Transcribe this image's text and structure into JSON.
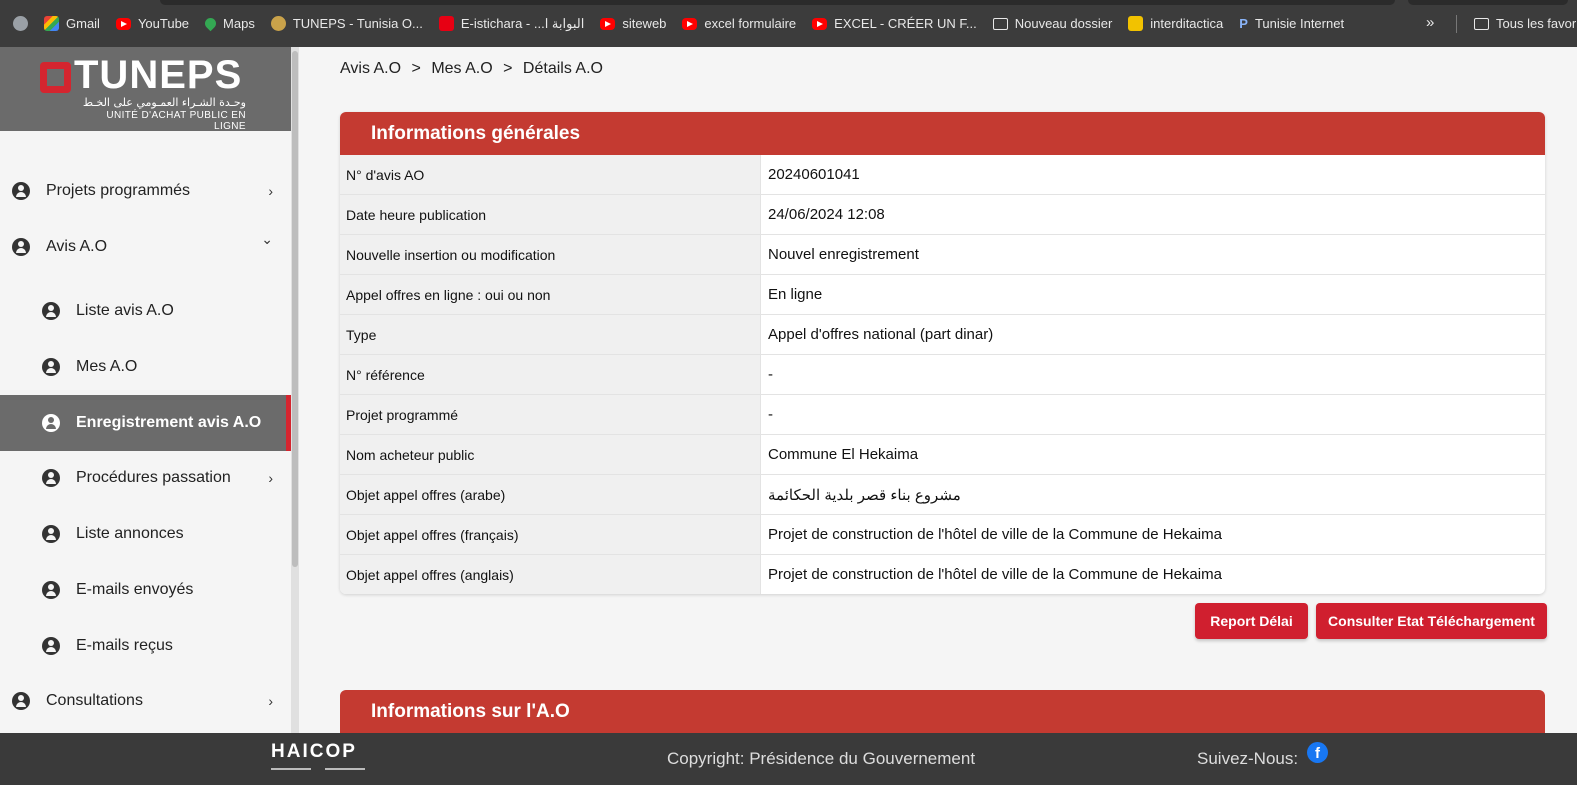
{
  "bookmarks": {
    "items": [
      {
        "label": "Gmail",
        "icon": "gmail-icon"
      },
      {
        "label": "YouTube",
        "icon": "youtube-icon"
      },
      {
        "label": "Maps",
        "icon": "maps-icon"
      },
      {
        "label": "TUNEPS - Tunisia O...",
        "icon": "tuneps-icon"
      },
      {
        "label": "E-istichara - ...البوابة ا",
        "icon": "tunisia-flag-icon"
      },
      {
        "label": "siteweb",
        "icon": "youtube-icon"
      },
      {
        "label": "excel formulaire",
        "icon": "youtube-icon"
      },
      {
        "label": "EXCEL - CRÉER UN F...",
        "icon": "youtube-icon"
      },
      {
        "label": "Nouveau dossier",
        "icon": "folder-icon"
      },
      {
        "label": "interditactica",
        "icon": "interditactica-icon"
      },
      {
        "label": "Tunisie Internet",
        "icon": "p-icon"
      }
    ],
    "more": "»",
    "all_bookmarks": "Tous les favoris"
  },
  "logo": {
    "name": "TUNEPS",
    "arabic": "وحـدة الشـراء العمـومي على الخـط",
    "subtitle": "UNITÉ D'ACHAT PUBLIC EN LIGNE"
  },
  "sidebar": {
    "items": [
      {
        "label": "Projets programmés",
        "chevron": "›"
      },
      {
        "label": "Avis A.O",
        "chevron": "⌄"
      },
      {
        "label": "Liste avis A.O"
      },
      {
        "label": "Mes A.O"
      },
      {
        "label": "Enregistrement avis A.O"
      },
      {
        "label": "Procédures passation",
        "chevron": "›"
      },
      {
        "label": "Liste annonces"
      },
      {
        "label": "E-mails envoyés"
      },
      {
        "label": "E-mails reçus"
      },
      {
        "label": "Consultations",
        "chevron": "›"
      }
    ]
  },
  "breadcrumb": {
    "items": [
      "Avis A.O",
      "Mes A.O",
      "Détails A.O"
    ],
    "separator": ">"
  },
  "general_info": {
    "title": "Informations générales",
    "rows": [
      {
        "label": "N° d'avis AO",
        "value": "20240601041"
      },
      {
        "label": "Date heure publication",
        "value": "24/06/2024 12:08"
      },
      {
        "label": "Nouvelle insertion ou modification",
        "value": "Nouvel enregistrement"
      },
      {
        "label": "Appel offres en ligne : oui ou non",
        "value": "En ligne"
      },
      {
        "label": "Type",
        "value": "Appel d'offres national (part dinar)"
      },
      {
        "label": "N° référence",
        "value": "-"
      },
      {
        "label": "Projet programmé",
        "value": "-"
      },
      {
        "label": "Nom acheteur public",
        "value": "Commune El Hekaima"
      },
      {
        "label": "Objet appel offres (arabe)",
        "value": "مشروع بناء قصر بلدية الحكائمة"
      },
      {
        "label": "Objet appel offres (français)",
        "value": "Projet de construction de l'hôtel de ville de la Commune de Hekaima"
      },
      {
        "label": "Objet appel offres (anglais)",
        "value": "Projet de construction de l'hôtel de ville de la Commune de Hekaima"
      }
    ]
  },
  "actions": {
    "report_label": "Report Délai",
    "consult_label": "Consulter Etat Téléchargement"
  },
  "ao_info": {
    "title": "Informations sur l'A.O"
  },
  "footer": {
    "logo": "HAICOP",
    "copyright": "Copyright: Présidence du Gouvernement",
    "follow": "Suivez-Nous:"
  },
  "colors": {
    "accent_red": "#c43a31",
    "button_red": "#d01f2f",
    "sidebar_active": "#6b6b6b"
  }
}
